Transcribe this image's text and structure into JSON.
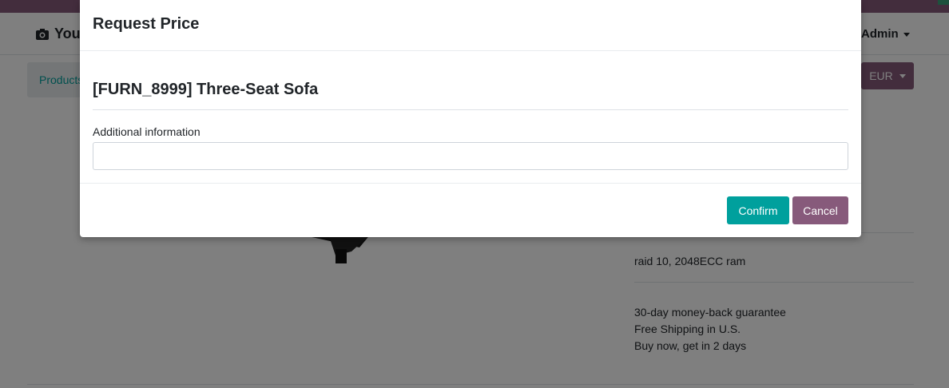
{
  "page": {
    "brand": "Your",
    "user_menu": "Admin",
    "breadcrumb": "Products",
    "currency": "EUR",
    "spec": "raid 10, 2048ECC ram",
    "terms": [
      "30-day money-back guarantee",
      "Free Shipping in U.S.",
      "Buy now, get in 2 days"
    ],
    "colors": {
      "primary": "#00a09d",
      "secondary": "#875a7b"
    }
  },
  "modal": {
    "title": "Request Price",
    "product": "[FURN_8999] Three-Seat Sofa",
    "info_label": "Additional information",
    "info_value": "",
    "confirm_label": "Confirm",
    "cancel_label": "Cancel"
  }
}
